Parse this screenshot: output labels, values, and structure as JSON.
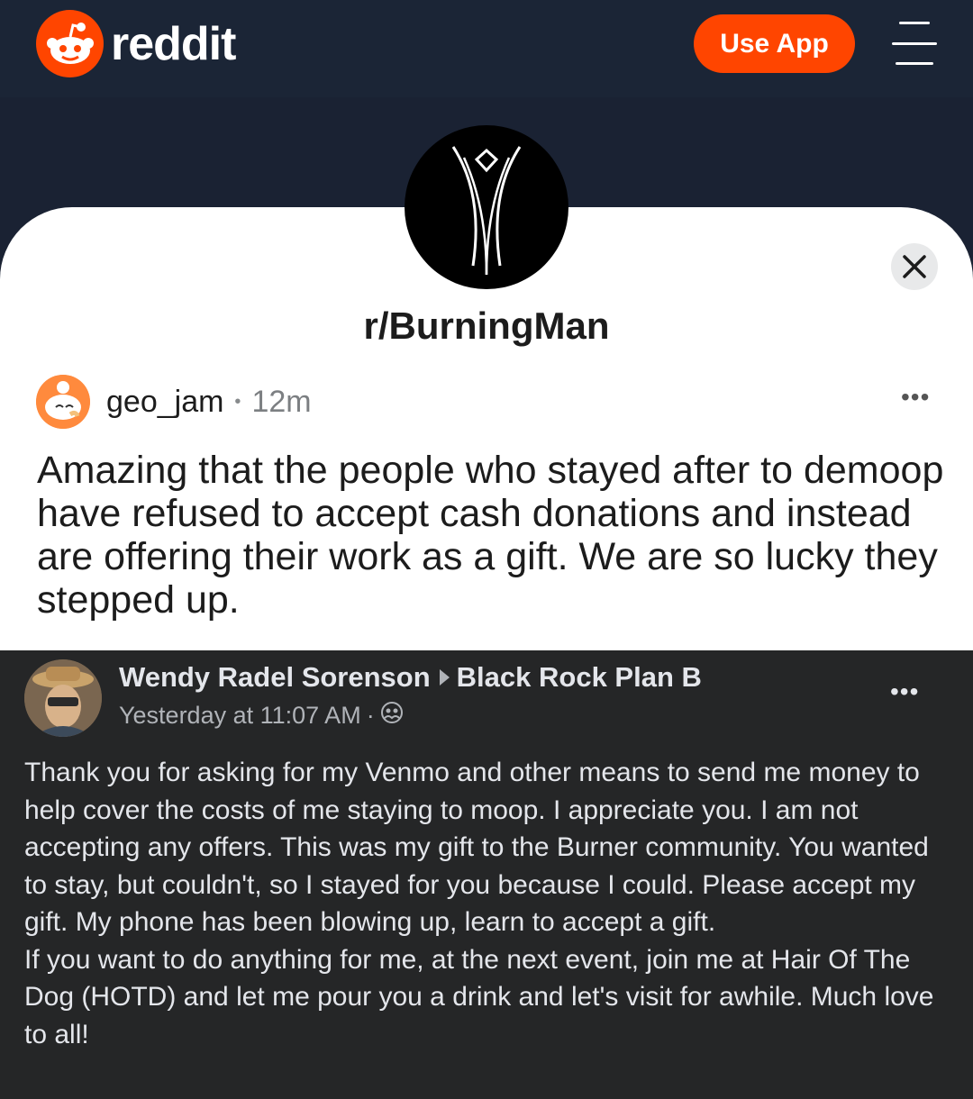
{
  "header": {
    "brand": "reddit",
    "use_app_label": "Use App",
    "logo_icon": "reddit-snoo-icon",
    "menu_icon": "hamburger-menu-icon"
  },
  "community": {
    "name": "r/BurningMan",
    "avatar_icon": "burning-man-figure-icon",
    "close_icon": "close-icon"
  },
  "post": {
    "author": "geo_jam",
    "separator": "•",
    "age": "12m",
    "more_label": "•••",
    "title": "Amazing that the people who stayed after to demoop have refused to accept cash donations and instead are offering their work as a gift. We are so lucky they stepped up."
  },
  "embedded_facebook_post": {
    "author": "Wendy Radel Sorenson",
    "group": "Black Rock Plan B",
    "timestamp": "Yesterday at 11:07 AM",
    "separator": "·",
    "privacy_icon": "group-privacy-icon",
    "more_label": "•••",
    "body": "Thank you for asking for my Venmo and other means to send me money to help cover the costs of me staying to moop. I appreciate you. I am not accepting any offers. This was my gift to the Burner community. You wanted to stay, but couldn't, so I stayed for you because I could. Please accept my gift. My phone has been blowing up, learn to accept a gift.\nIf you want to do anything for me, at the next event, join me at Hair Of The Dog (HOTD) and let me pour you a drink and let's visit for awhile. Much love to all!"
  },
  "colors": {
    "brand_orange": "#ff4500",
    "header_bg": "#1b2536",
    "fb_bg": "#252627"
  }
}
